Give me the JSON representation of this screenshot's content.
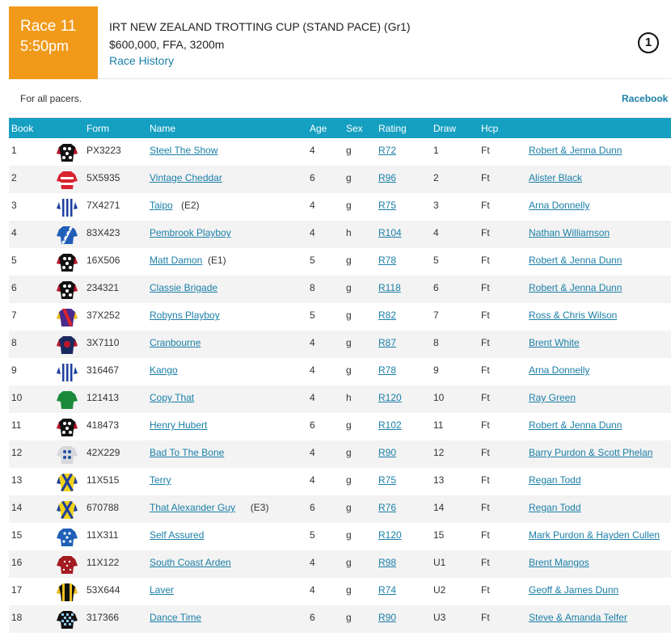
{
  "race": {
    "number_label": "Race 11",
    "time": "5:50pm",
    "title": "IRT NEW ZEALAND TROTTING CUP (STAND PACE) (Gr1)",
    "meta": "$600,000, FFA, 3200m",
    "history_link": "Race History",
    "badge_glyph": "1",
    "edge_glyph": "↗"
  },
  "subheader": {
    "note": "For all pacers.",
    "racebook_link": "Racebook ›"
  },
  "columns": {
    "book": "Book",
    "form": "Form",
    "name": "Name",
    "age": "Age",
    "sex": "Sex",
    "rating": "Rating",
    "draw": "Draw",
    "hcp": "Hcp"
  },
  "colors": {
    "accent_orange": "#f19a1a",
    "header_blue": "#159fc1",
    "link_blue": "#1a7fa8"
  },
  "runners": [
    {
      "book": "1",
      "silk": "black-white-spots",
      "form": "PX3223",
      "name": "Steel The Show",
      "tag": "",
      "age": "4",
      "sex": "g",
      "rating": "R72",
      "draw": "1",
      "hcp": "Ft",
      "trainer": "Robert & Jenna Dunn"
    },
    {
      "book": "2",
      "silk": "red-white-hoops",
      "form": "5X5935",
      "name": "Vintage Cheddar",
      "tag": "",
      "age": "6",
      "sex": "g",
      "rating": "R96",
      "draw": "2",
      "hcp": "Ft",
      "trainer": "Alister Black"
    },
    {
      "book": "3",
      "silk": "blue-white-stripes",
      "form": "7X4271",
      "name": "Taipo",
      "tag": "(E2)",
      "age": "4",
      "sex": "g",
      "rating": "R75",
      "draw": "3",
      "hcp": "Ft",
      "trainer": "Arna Donnelly"
    },
    {
      "book": "4",
      "silk": "blue-white-sash",
      "form": "83X423",
      "name": "Pembrook Playboy",
      "tag": "",
      "age": "4",
      "sex": "h",
      "rating": "R104",
      "draw": "4",
      "hcp": "Ft",
      "trainer": "Nathan Williamson"
    },
    {
      "book": "5",
      "silk": "black-white-spots",
      "form": "16X506",
      "name": "Matt Damon",
      "tag": "(E1)",
      "age": "5",
      "sex": "g",
      "rating": "R78",
      "draw": "5",
      "hcp": "Ft",
      "trainer": "Robert & Jenna Dunn"
    },
    {
      "book": "6",
      "silk": "black-white-spots",
      "form": "234321",
      "name": "Classie Brigade",
      "tag": "",
      "age": "8",
      "sex": "g",
      "rating": "R118",
      "draw": "6",
      "hcp": "Ft",
      "trainer": "Robert & Jenna Dunn"
    },
    {
      "book": "7",
      "silk": "purple-red-sash",
      "form": "37X252",
      "name": "Robyns Playboy",
      "tag": "",
      "age": "5",
      "sex": "g",
      "rating": "R82",
      "draw": "7",
      "hcp": "Ft",
      "trainer": "Ross & Chris Wilson"
    },
    {
      "book": "8",
      "silk": "navy-red-star",
      "form": "3X7110",
      "name": "Cranbourne",
      "tag": "",
      "age": "4",
      "sex": "g",
      "rating": "R87",
      "draw": "8",
      "hcp": "Ft",
      "trainer": "Brent White"
    },
    {
      "book": "9",
      "silk": "blue-white-stripes",
      "form": "316467",
      "name": "Kango",
      "tag": "",
      "age": "4",
      "sex": "g",
      "rating": "R78",
      "draw": "9",
      "hcp": "Ft",
      "trainer": "Arna Donnelly"
    },
    {
      "book": "10",
      "silk": "green",
      "form": "121413",
      "name": "Copy That",
      "tag": "",
      "age": "4",
      "sex": "h",
      "rating": "R120",
      "draw": "10",
      "hcp": "Ft",
      "trainer": "Ray Green"
    },
    {
      "book": "11",
      "silk": "black-white-spots",
      "form": "418473",
      "name": "Henry Hubert",
      "tag": "",
      "age": "6",
      "sex": "g",
      "rating": "R102",
      "draw": "11",
      "hcp": "Ft",
      "trainer": "Robert & Jenna Dunn"
    },
    {
      "book": "12",
      "silk": "grey-blue-spots",
      "form": "42X229",
      "name": "Bad To The Bone",
      "tag": "",
      "age": "4",
      "sex": "g",
      "rating": "R90",
      "draw": "12",
      "hcp": "Ft",
      "trainer": "Barry Purdon & Scott Phelan"
    },
    {
      "book": "13",
      "silk": "yellow-blue-cross",
      "form": "11X515",
      "name": "Terry",
      "tag": "",
      "age": "4",
      "sex": "g",
      "rating": "R75",
      "draw": "13",
      "hcp": "Ft",
      "trainer": "Regan Todd"
    },
    {
      "book": "14",
      "silk": "yellow-blue-cross",
      "form": "670788",
      "name": "That Alexander Guy",
      "tag": "(E3)",
      "age": "6",
      "sex": "g",
      "rating": "R76",
      "draw": "14",
      "hcp": "Ft",
      "trainer": "Regan Todd"
    },
    {
      "book": "15",
      "silk": "blue-white-spots",
      "form": "11X311",
      "name": "Self Assured",
      "tag": "",
      "age": "5",
      "sex": "g",
      "rating": "R120",
      "draw": "15",
      "hcp": "Ft",
      "trainer": "Mark Purdon & Hayden Cullen"
    },
    {
      "book": "16",
      "silk": "maroon-white-spots",
      "form": "11X122",
      "name": "South Coast Arden",
      "tag": "",
      "age": "4",
      "sex": "g",
      "rating": "R98",
      "draw": "U1",
      "hcp": "Ft",
      "trainer": "Brent Mangos"
    },
    {
      "book": "17",
      "silk": "black-yellow-stripes",
      "form": "53X644",
      "name": "Laver",
      "tag": "",
      "age": "4",
      "sex": "g",
      "rating": "R74",
      "draw": "U2",
      "hcp": "Ft",
      "trainer": "Geoff & James Dunn"
    },
    {
      "book": "18",
      "silk": "black-blue-checks",
      "form": "317366",
      "name": "Dance Time",
      "tag": "",
      "age": "6",
      "sex": "g",
      "rating": "R90",
      "draw": "U3",
      "hcp": "Ft",
      "trainer": "Steve & Amanda Telfer"
    }
  ]
}
